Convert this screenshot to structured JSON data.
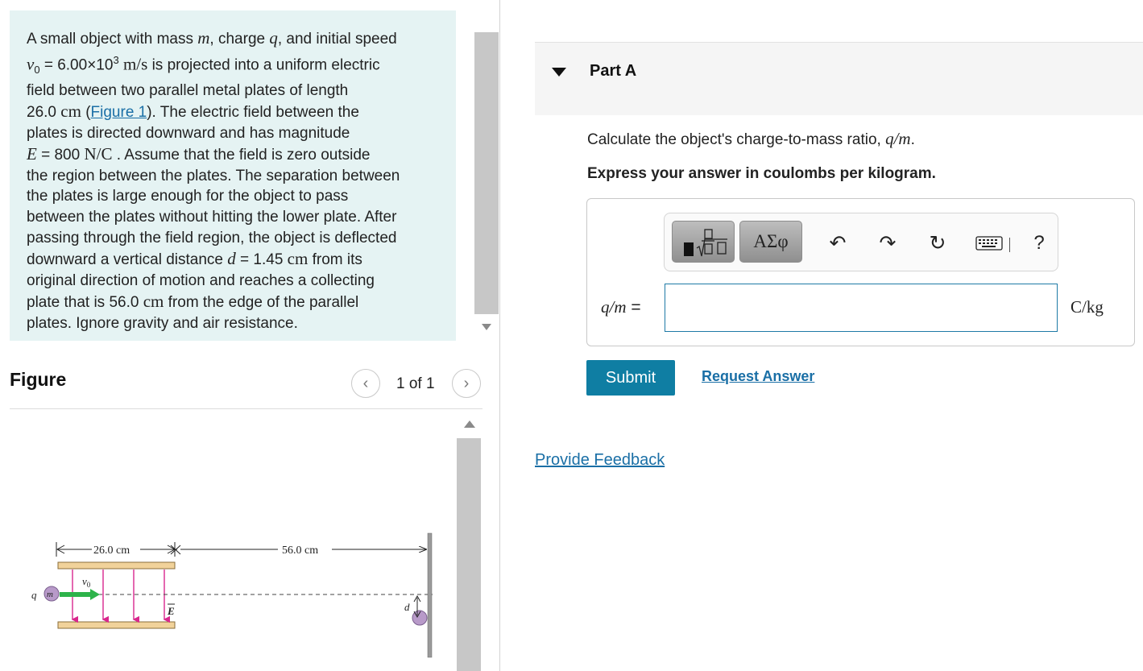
{
  "problem": {
    "lines": [
      [
        "A small object with mass ",
        "m",
        ", charge ",
        "q",
        ", and initial speed"
      ],
      [
        "v",
        "0",
        " = 6.00×10",
        "3",
        "m/s",
        " is projected into a uniform electric"
      ],
      [
        "field between two parallel metal plates of length"
      ],
      [
        "26.0 ",
        "cm",
        " (",
        "Figure 1",
        "). The electric field between the"
      ],
      [
        "plates is directed downward and has magnitude"
      ],
      [
        "E",
        " = 800 ",
        "N/C",
        " . Assume that the field is zero outside"
      ],
      [
        "the region between the plates. The separation between"
      ],
      [
        "the plates is large enough for the object to pass"
      ],
      [
        "between the plates without hitting the lower plate. After"
      ],
      [
        "passing through the field region, the object is deflected"
      ],
      [
        "downward a vertical distance ",
        "d",
        " = 1.45 ",
        "cm",
        " from its"
      ],
      [
        "original direction of motion and reaches a collecting"
      ],
      [
        "plate that is 56.0 ",
        "cm",
        " from the edge of the parallel"
      ],
      [
        "plates. Ignore gravity and air resistance."
      ]
    ]
  },
  "figure": {
    "title": "Figure",
    "pager": "1 of 1",
    "labels": {
      "plate_length": "26.0 cm",
      "distance": "56.0 cm",
      "v0": "v",
      "v0_sub": "0",
      "field": "E",
      "charge": "q",
      "mass": "m",
      "deflection": "d"
    }
  },
  "part": {
    "title": "Part A",
    "question_text": "Calculate the object's charge-to-mass ratio, ",
    "question_math": "q/m",
    "question_end": ".",
    "instruction": "Express your answer in coulombs per kilogram.",
    "toolbar": {
      "templates_icon": "fraction-sqrt-template-icon",
      "symbols_label": "ΑΣφ",
      "undo_icon": "undo-icon",
      "redo_icon": "redo-icon",
      "reset_icon": "reset-icon",
      "keyboard_icon": "keyboard-icon",
      "help_label": "?"
    },
    "answer_label": "q/m",
    "answer_equals": " =",
    "answer_value": "",
    "unit": "C/kg",
    "submit_label": "Submit",
    "request_label": "Request Answer"
  },
  "feedback_label": "Provide Feedback",
  "colors": {
    "problem_bg": "#e5f3f3",
    "link": "#1a6fa6",
    "submit_bg": "#0f7ea3",
    "field_arrow": "#d9268d",
    "velocity_arrow": "#2db34a",
    "plate": "#f1d29a"
  }
}
